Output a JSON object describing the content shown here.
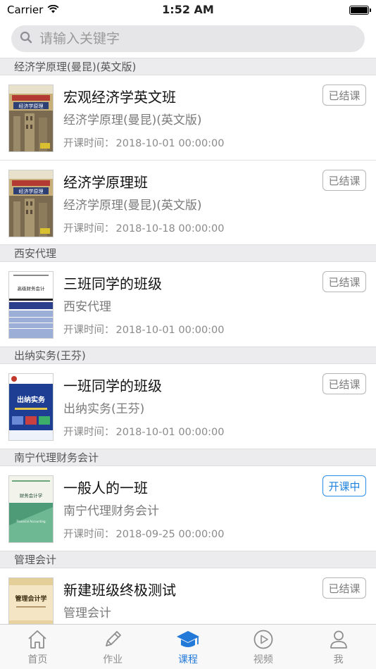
{
  "status_bar": {
    "carrier": "Carrier",
    "time": "1:52 AM",
    "battery_level": 1.0
  },
  "search": {
    "placeholder": "请输入关键字"
  },
  "sections": [
    {
      "header": "经济学原理(曼昆)(英文版)",
      "courses": [
        {
          "title": "宏观经济学英文班",
          "subtitle": "经济学原理(曼昆)(英文版)",
          "time_label": "开课时间：",
          "time": "2018-10-01 00:00:00",
          "status": "已结课",
          "active": false,
          "cover": "econ"
        },
        {
          "title": "经济学原理班",
          "subtitle": "经济学原理(曼昆)(英文版)",
          "time_label": "开课时间：",
          "time": "2018-10-18 00:00:00",
          "status": "已结课",
          "active": false,
          "cover": "econ"
        }
      ]
    },
    {
      "header": "西安代理",
      "courses": [
        {
          "title": "三班同学的班级",
          "subtitle": "西安代理",
          "time_label": "开课时间：",
          "time": "2018-10-01 00:00:00",
          "status": "已结课",
          "active": false,
          "cover": "advanced-accounting"
        }
      ]
    },
    {
      "header": "出纳实务(王芬)",
      "courses": [
        {
          "title": "一班同学的班级",
          "subtitle": "出纳实务(王芬)",
          "time_label": "开课时间：",
          "time": "2018-10-01 00:00:00",
          "status": "已结课",
          "active": false,
          "cover": "cashier"
        }
      ]
    },
    {
      "header": "南宁代理财务会计",
      "courses": [
        {
          "title": "一般人的一班",
          "subtitle": "南宁代理财务会计",
          "time_label": "开课时间：",
          "time": "2018-09-25 00:00:00",
          "status": "开课中",
          "active": true,
          "cover": "financial"
        }
      ]
    },
    {
      "header": "管理会计",
      "courses": [
        {
          "title": "新建班级终极测试",
          "subtitle": "管理会计",
          "time_label": "",
          "time": "",
          "status": "已结课",
          "active": false,
          "cover": "management"
        }
      ]
    }
  ],
  "cover_texts": {
    "econ_title": "经济学原理",
    "advanced": "高级财务会计",
    "cashier": "出纳实务",
    "financial": "财务会计学",
    "financial_en": "Financial Accounting",
    "management": "管理会计学"
  },
  "tabs": [
    {
      "label": "首页",
      "icon": "home-icon",
      "active": false
    },
    {
      "label": "作业",
      "icon": "pencil-icon",
      "active": false
    },
    {
      "label": "课程",
      "icon": "graduation-cap-icon",
      "active": true
    },
    {
      "label": "视频",
      "icon": "play-circle-icon",
      "active": false
    },
    {
      "label": "我",
      "icon": "person-icon",
      "active": false
    }
  ],
  "colors": {
    "accent": "#2379d8",
    "inactive": "#8e8e8e",
    "section_bg": "#ececee"
  }
}
